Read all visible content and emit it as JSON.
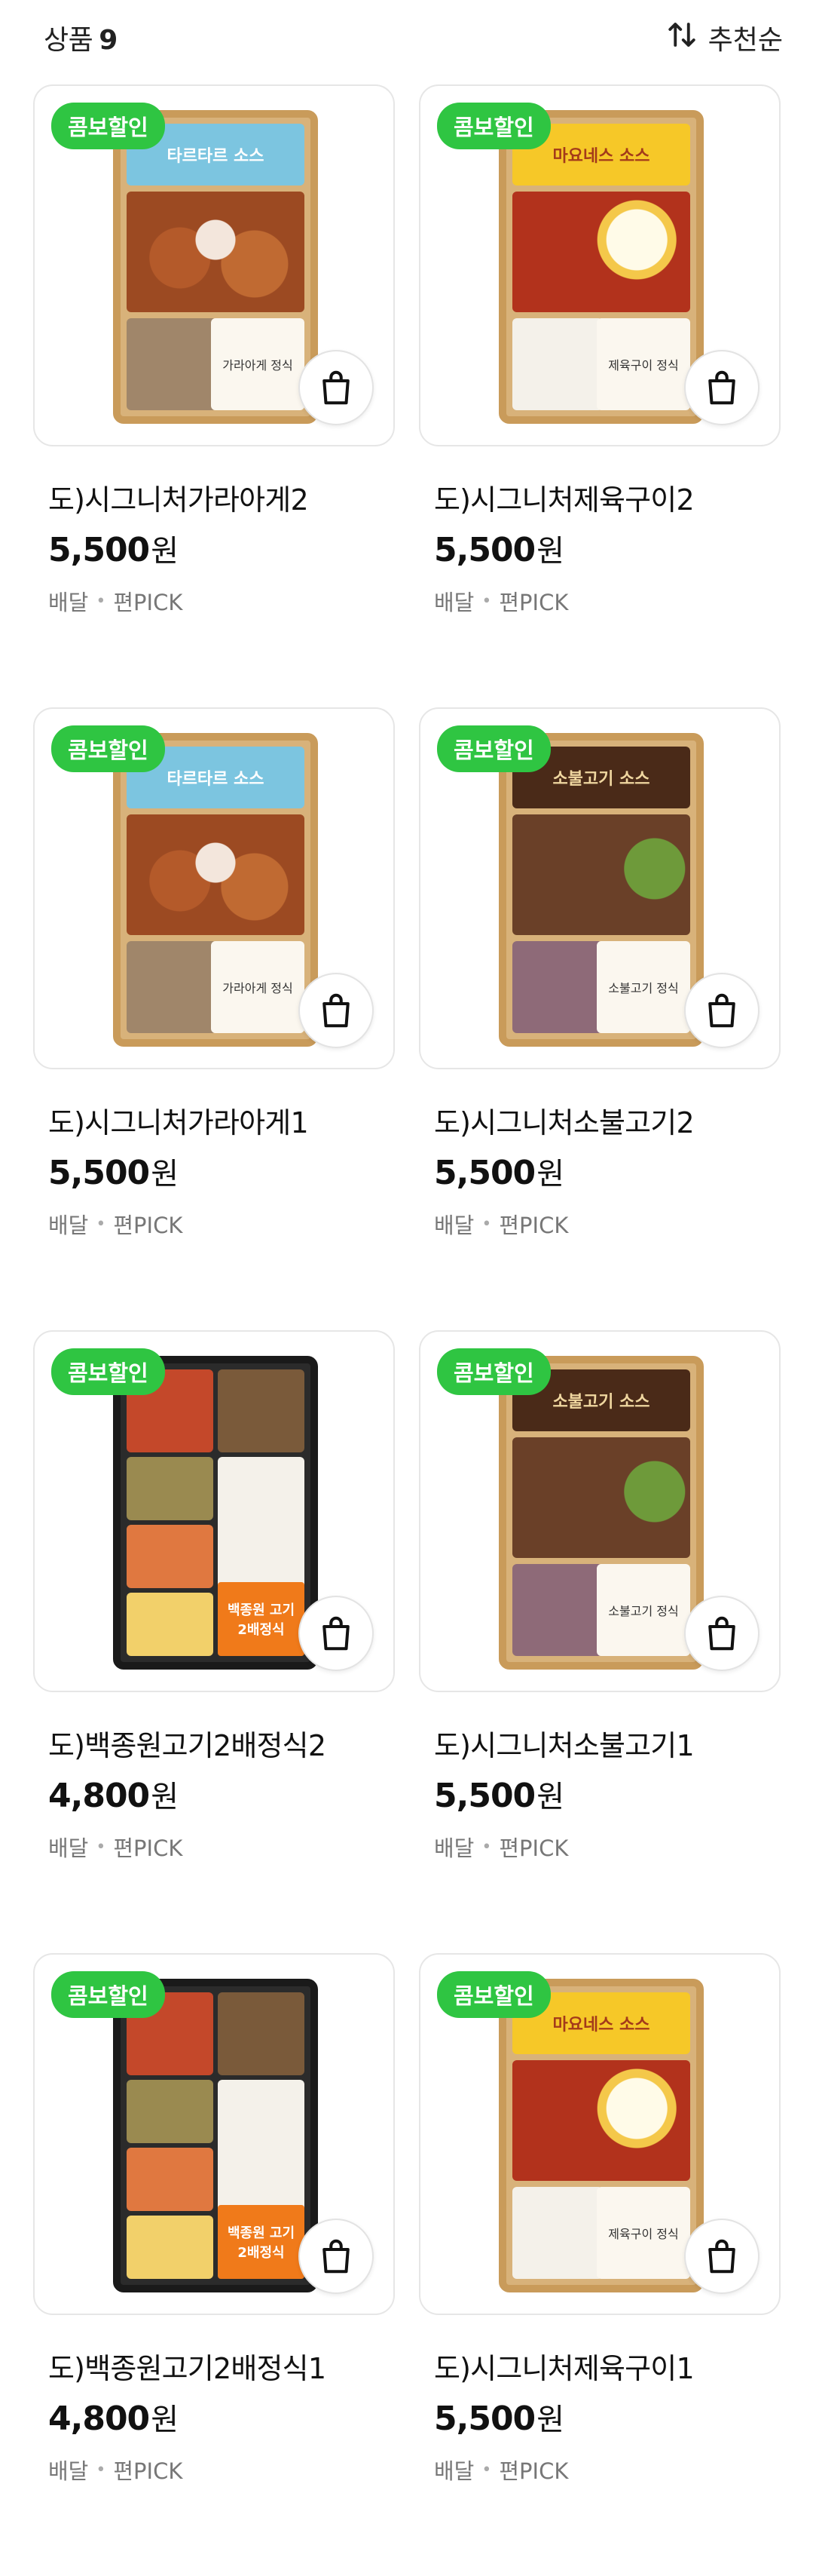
{
  "header": {
    "count_label": "상품",
    "count_value": "9",
    "sort_label": "추천순",
    "sort_icon": "sort-arrows-icon"
  },
  "badge_text": "콤보할인",
  "currency": "원",
  "colors": {
    "badge_bg": "#2fc542",
    "text_primary": "#111111",
    "text_secondary": "#777777"
  },
  "products": [
    {
      "name": "도)시그니처가라아게2",
      "price": "5,500",
      "tags": [
        "배달",
        "편PICK"
      ],
      "sauce_label": "타르타르 소스",
      "box_label": "가라아게 정식"
    },
    {
      "name": "도)시그니처제육구이2",
      "price": "5,500",
      "tags": [
        "배달",
        "편PICK"
      ],
      "sauce_label": "마요네스 소스",
      "box_label": "제육구이 정식"
    },
    {
      "name": "도)시그니처가라아게1",
      "price": "5,500",
      "tags": [
        "배달",
        "편PICK"
      ],
      "sauce_label": "타르타르 소스",
      "box_label": "가라아게 정식"
    },
    {
      "name": "도)시그니처소불고기2",
      "price": "5,500",
      "tags": [
        "배달",
        "편PICK"
      ],
      "sauce_label": "소불고기 소스",
      "box_label": "소불고기 정식"
    },
    {
      "name": "도)백종원고기2배정식2",
      "price": "4,800",
      "tags": [
        "배달",
        "편PICK"
      ],
      "box_label": "백종원 고기 2배정식"
    },
    {
      "name": "도)시그니처소불고기1",
      "price": "5,500",
      "tags": [
        "배달",
        "편PICK"
      ],
      "sauce_label": "소불고기 소스",
      "box_label": "소불고기 정식"
    },
    {
      "name": "도)백종원고기2배정식1",
      "price": "4,800",
      "tags": [
        "배달",
        "편PICK"
      ],
      "box_label": "백종원 고기 2배정식"
    },
    {
      "name": "도)시그니처제육구이1",
      "price": "5,500",
      "tags": [
        "배달",
        "편PICK"
      ],
      "sauce_label": "마요네스 소스",
      "box_label": "제육구이 정식"
    }
  ]
}
